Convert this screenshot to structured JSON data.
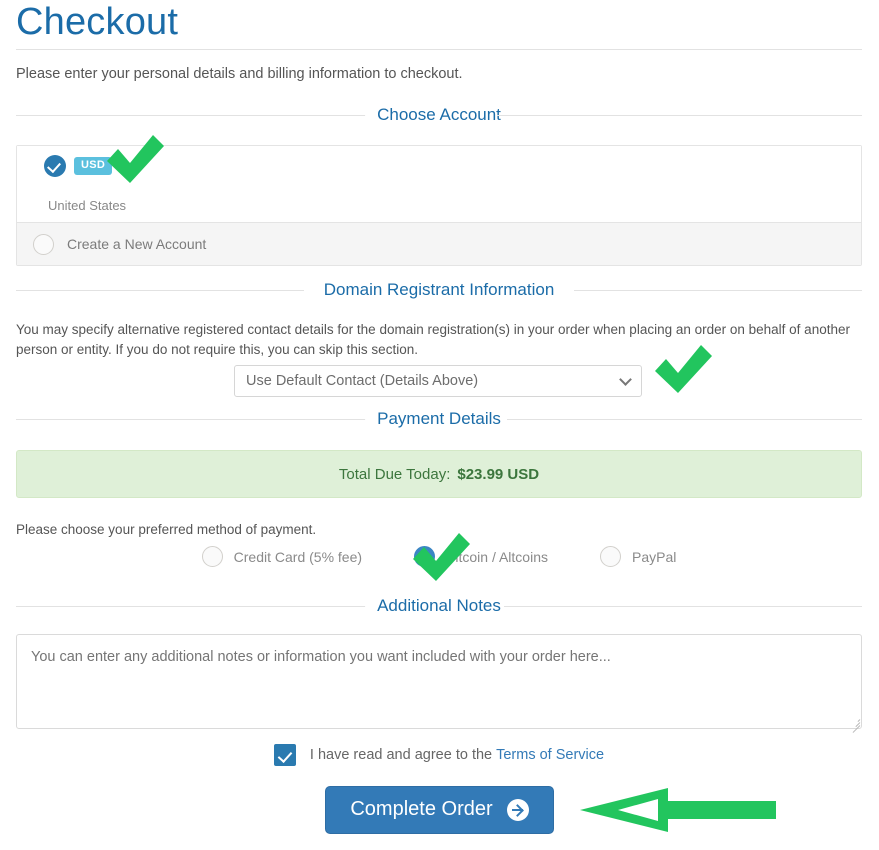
{
  "header": {
    "title": "Checkout",
    "intro": "Please enter your personal details and billing information to checkout."
  },
  "sections": {
    "account": "Choose Account",
    "registrant": "Domain Registrant Information",
    "payment": "Payment Details",
    "notes": "Additional Notes"
  },
  "account": {
    "currency_badge": "USD",
    "country": "United States",
    "new_account_label": "Create a New Account"
  },
  "registrant": {
    "description": "You may specify alternative registered contact details for the domain registration(s) in your order when placing an order on behalf of another person or entity. If you do not require this, you can skip this section.",
    "contact_selected": "Use Default Contact (Details Above)"
  },
  "payment": {
    "total_label": "Total Due Today:",
    "total_amount": "$23.99 USD",
    "prompt": "Please choose your preferred method of payment.",
    "methods": [
      {
        "label": "Credit Card (5% fee)",
        "selected": false
      },
      {
        "label": "Bitcoin / Altcoins",
        "selected": true
      },
      {
        "label": "PayPal",
        "selected": false
      }
    ]
  },
  "notes": {
    "placeholder": "You can enter any additional notes or information you want included with your order here...",
    "value": ""
  },
  "terms": {
    "text": "I have read and agree to the",
    "link": "Terms of Service",
    "checked": true
  },
  "submit": {
    "label": "Complete Order"
  },
  "colors": {
    "brand_blue": "#337ab7",
    "title_blue": "#1b6ca8",
    "badge_blue": "#5bc0de",
    "success_bg": "#dff0d8",
    "success_text": "#3c763d",
    "annotation_green": "#22c55e"
  }
}
